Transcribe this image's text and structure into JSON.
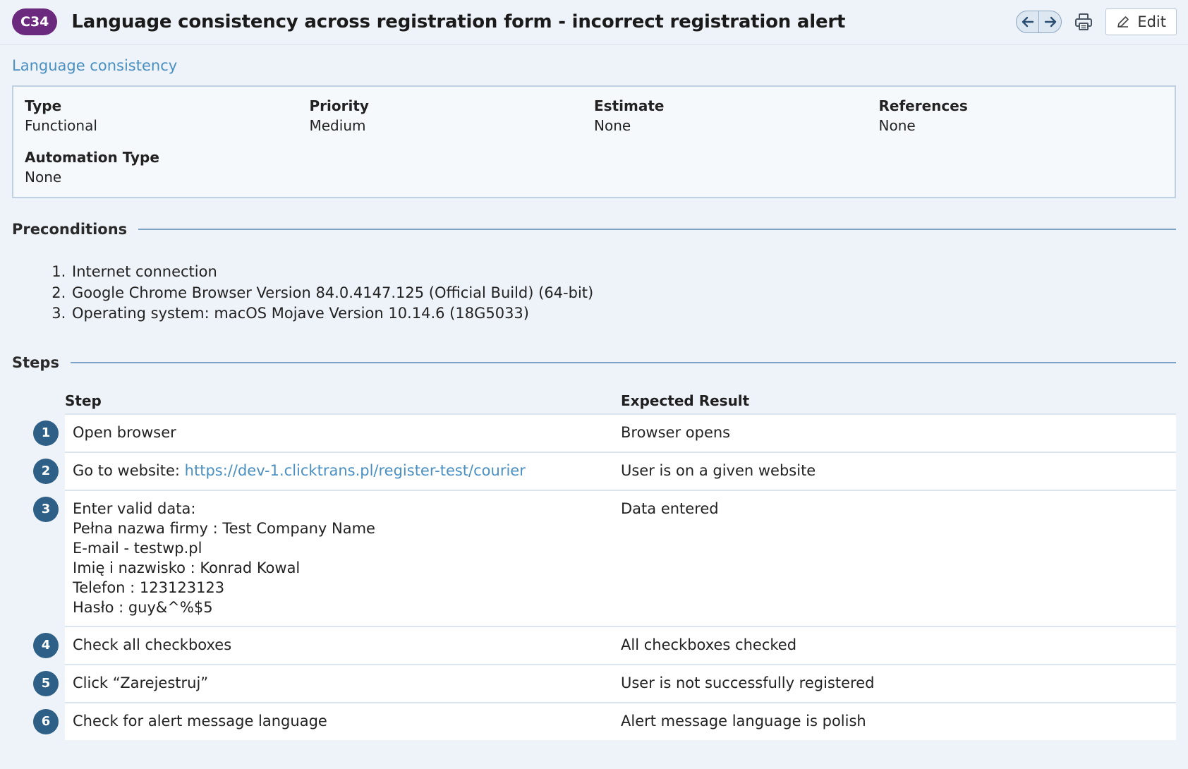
{
  "header": {
    "case_id": "C34",
    "title": "Language consistency across registration form - incorrect registration alert",
    "edit_label": "Edit",
    "icons": [
      "arrow-left-icon",
      "arrow-right-icon",
      "printer-icon",
      "pencil-icon"
    ]
  },
  "section_link": "Language consistency",
  "properties": {
    "type_label": "Type",
    "type_value": "Functional",
    "priority_label": "Priority",
    "priority_value": "Medium",
    "estimate_label": "Estimate",
    "estimate_value": "None",
    "references_label": "References",
    "references_value": "None",
    "automation_label": "Automation Type",
    "automation_value": "None"
  },
  "preconditions": {
    "heading": "Preconditions",
    "items": [
      "Internet connection",
      "Google Chrome Browser Version 84.0.4147.125 (Official Build) (64-bit)",
      "Operating system: macOS Mojave Version 10.14.6 (18G5033)"
    ]
  },
  "steps": {
    "heading": "Steps",
    "col_step": "Step",
    "col_expected": "Expected Result",
    "rows": [
      {
        "num": "1",
        "step": "Open browser",
        "expected": "Browser opens"
      },
      {
        "num": "2",
        "step_prefix": "Go to website: ",
        "step_link": "https://dev-1.clicktrans.pl/register-test/courier",
        "expected": "User is on a given website"
      },
      {
        "num": "3",
        "step_lines": [
          "Enter valid data:",
          "Pełna nazwa firmy : Test Company Name",
          "E-mail - testwp.pl",
          "Imię i nazwisko : Konrad Kowal",
          "Telefon : 123123123",
          "Hasło : guy&^%$5"
        ],
        "expected": "Data entered"
      },
      {
        "num": "4",
        "step": "Check all checkboxes",
        "expected": "All checkboxes checked"
      },
      {
        "num": "5",
        "step": "Click “Zarejestruj”",
        "expected": "User is not successfully registered"
      },
      {
        "num": "6",
        "step": "Check for alert message language",
        "expected": "Alert message language is polish"
      }
    ]
  },
  "colors": {
    "badge": "#6c2a7e",
    "step_circle": "#2e5f86",
    "link": "#4a8fc1",
    "rule": "#7ca3c6"
  }
}
